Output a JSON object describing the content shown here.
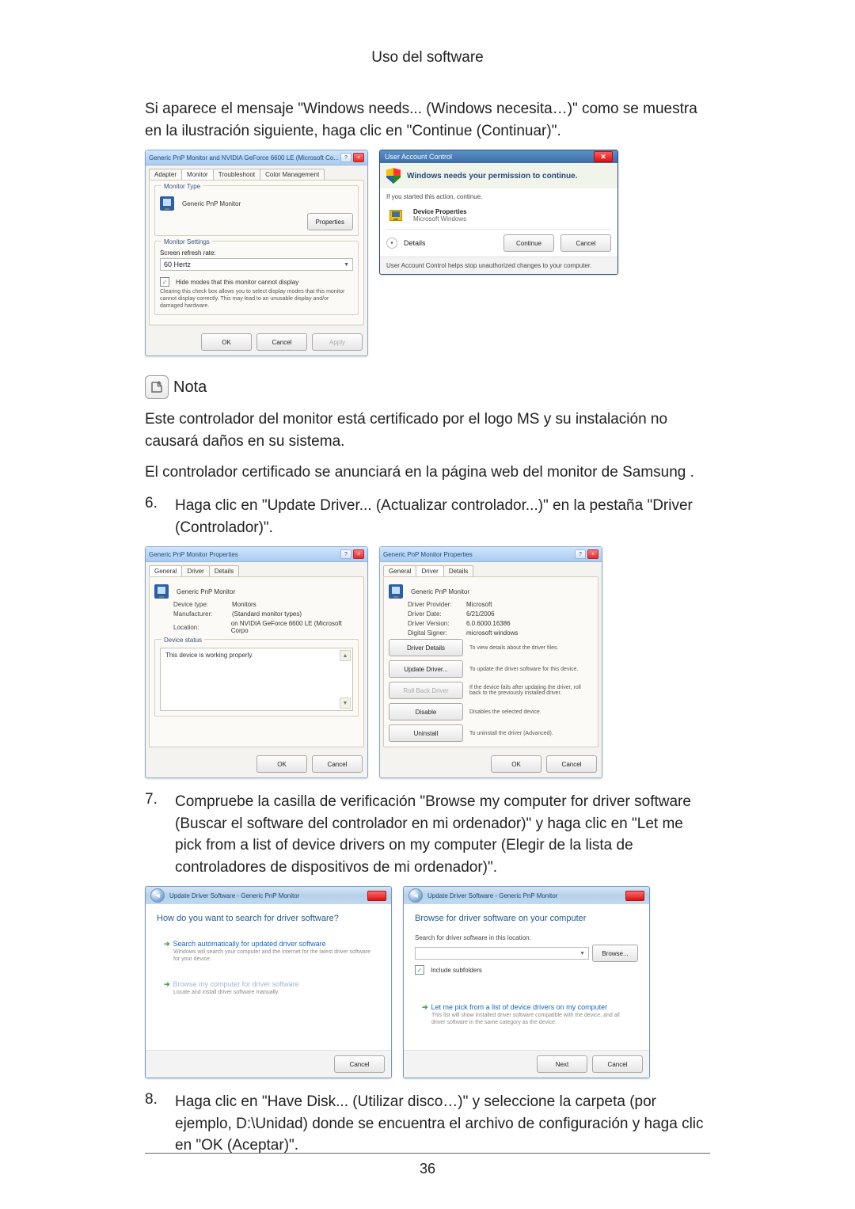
{
  "section_title": "Uso del software",
  "page_number": "36",
  "intro_para": "Si aparece el mensaje \"Windows needs... (Windows necesita…)\" como se muestra en la ilustración siguiente, haga clic en \"Continue (Continuar)\".",
  "nota": {
    "label": "Nota",
    "line1": "Este controlador del monitor está certificado por el logo MS y su instalación no causará daños en su sistema.",
    "line2": "El controlador certificado se anunciará en la página web del monitor de Samsung ."
  },
  "steps": {
    "s6": {
      "num": "6.",
      "text": "Haga clic en \"Update Driver... (Actualizar controlador...)\" en la pestaña \"Driver (Controlador)\"."
    },
    "s7": {
      "num": "7.",
      "text": "Compruebe la casilla de verificación \"Browse my computer for driver software (Buscar el software del controlador en mi ordenador)\" y haga clic en \"Let me pick from a list of device drivers on my computer (Elegir de la lista de controladores de dispositivos de mi ordenador)\"."
    },
    "s8": {
      "num": "8.",
      "text": "Haga clic en \"Have Disk... (Utilizar disco…)\" y seleccione la carpeta (por ejemplo, D:\\Unidad) donde se encuentra el archivo de configuración y haga clic en \"OK (Aceptar)\"."
    }
  },
  "monitor_props": {
    "title": "Generic PnP Monitor and NVIDIA GeForce 6600 LE (Microsoft Co...",
    "tabs": {
      "adapter": "Adapter",
      "monitor": "Monitor",
      "troubleshoot": "Troubleshoot",
      "color": "Color Management"
    },
    "type_label": "Monitor Type",
    "type_value": "Generic PnP Monitor",
    "properties_btn": "Properties",
    "settings_label": "Monitor Settings",
    "refresh_label": "Screen refresh rate:",
    "refresh_value": "60 Hertz",
    "hide_modes": "Hide modes that this monitor cannot display",
    "hide_desc": "Clearing this check box allows you to select display modes that this monitor cannot display correctly. This may lead to an unusable display and/or damaged hardware.",
    "ok": "OK",
    "cancel": "Cancel",
    "apply": "Apply"
  },
  "uac": {
    "title": "User Account Control",
    "banner": "Windows needs your permission to continue.",
    "hint": "If you started this action, continue.",
    "prog_name": "Device Properties",
    "prog_vendor": "Microsoft Windows",
    "details": "Details",
    "continue": "Continue",
    "cancel": "Cancel",
    "footer": "User Account Control helps stop unauthorized changes to your computer."
  },
  "props_general": {
    "title": "Generic PnP Monitor Properties",
    "tabs": {
      "general": "General",
      "driver": "Driver",
      "details": "Details"
    },
    "name": "Generic PnP Monitor",
    "dev_type_k": "Device type:",
    "dev_type_v": "Monitors",
    "manu_k": "Manufacturer:",
    "manu_v": "(Standard monitor types)",
    "loc_k": "Location:",
    "loc_v": "on NVIDIA GeForce 6600 LE (Microsoft Corpo",
    "status_label": "Device status",
    "status_text": "This device is working properly.",
    "ok": "OK",
    "cancel": "Cancel"
  },
  "props_driver": {
    "title": "Generic PnP Monitor Properties",
    "name": "Generic PnP Monitor",
    "provider_k": "Driver Provider:",
    "provider_v": "Microsoft",
    "date_k": "Driver Date:",
    "date_v": "6/21/2006",
    "version_k": "Driver Version:",
    "version_v": "6.0.6000.16386",
    "signer_k": "Digital Signer:",
    "signer_v": "microsoft windows",
    "btn_details": "Driver Details",
    "desc_details": "To view details about the driver files.",
    "btn_update": "Update Driver...",
    "desc_update": "To update the driver software for this device.",
    "btn_rollback": "Roll Back Driver",
    "desc_rollback": "If the device fails after updating the driver, roll back to the previously installed driver.",
    "btn_disable": "Disable",
    "desc_disable": "Disables the selected device.",
    "btn_uninstall": "Uninstall",
    "desc_uninstall": "To uninstall the driver (Advanced).",
    "ok": "OK",
    "cancel": "Cancel"
  },
  "wiz_search": {
    "crumb": "Update Driver Software - Generic PnP Monitor",
    "heading": "How do you want to search for driver software?",
    "opt1_title": "Search automatically for updated driver software",
    "opt1_sub": "Windows will search your computer and the Internet for the latest driver software for your device.",
    "opt2_title": "Browse my computer for driver software",
    "opt2_sub": "Locate and install driver software manually.",
    "cancel": "Cancel"
  },
  "wiz_browse": {
    "crumb": "Update Driver Software - Generic PnP Monitor",
    "heading": "Browse for driver software on your computer",
    "search_label": "Search for driver software in this location:",
    "path_value": "",
    "browse_btn": "Browse...",
    "include_sub": "Include subfolders",
    "opt_title": "Let me pick from a list of device drivers on my computer",
    "opt_sub": "This list will show installed driver software compatible with the device, and all driver software in the same category as the device.",
    "next": "Next",
    "cancel": "Cancel"
  }
}
